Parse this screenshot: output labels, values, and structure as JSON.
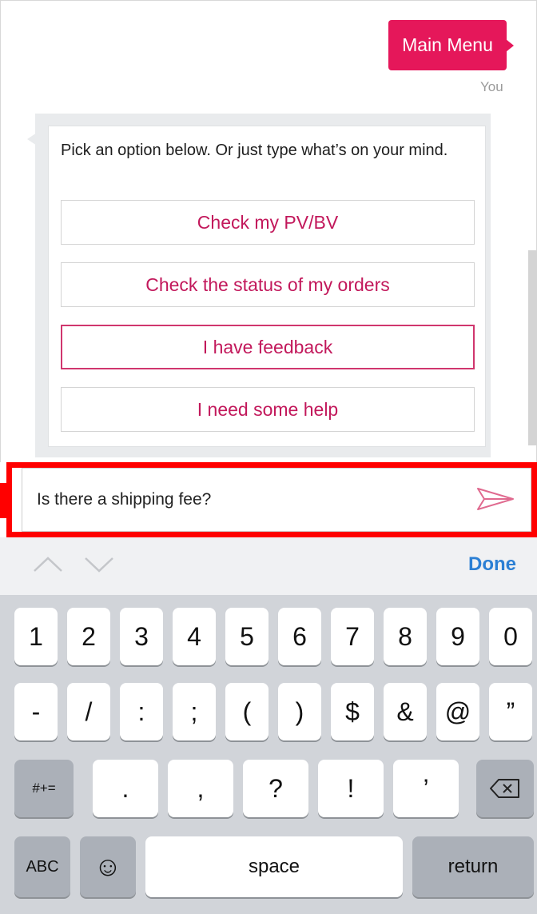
{
  "chat": {
    "user_message": "Main Menu",
    "user_label": "You",
    "bot_prompt": "Pick an option below. Or just type what’s on your mind.",
    "options": [
      {
        "label": "Check my PV/BV"
      },
      {
        "label": "Check the status of my orders"
      },
      {
        "label": "I have feedback"
      },
      {
        "label": "I need some help"
      }
    ]
  },
  "input": {
    "value": "Is there a shipping fee?"
  },
  "accessory": {
    "done_label": "Done"
  },
  "keyboard": {
    "row1": [
      "1",
      "2",
      "3",
      "4",
      "5",
      "6",
      "7",
      "8",
      "9",
      "0"
    ],
    "row2": [
      "-",
      "/",
      ":",
      ";",
      "(",
      ")",
      "$",
      "&",
      "@",
      "”"
    ],
    "row3": [
      "#+=",
      ".",
      ",",
      "?",
      "!",
      "’",
      "⌫"
    ],
    "row4": [
      "ABC",
      "☺",
      "space",
      "return"
    ]
  },
  "colors": {
    "accent": "#e5175a",
    "option_text": "#c2185b",
    "highlight": "#ff0000",
    "done": "#2b7fd4"
  }
}
